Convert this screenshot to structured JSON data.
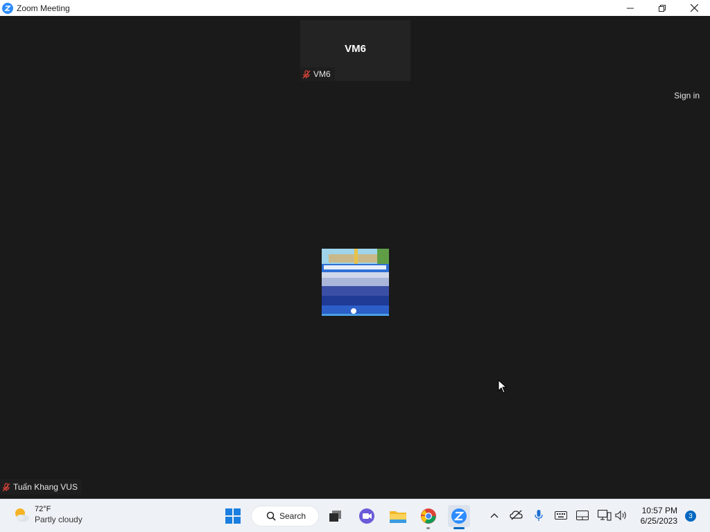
{
  "window": {
    "title": "Zoom Meeting",
    "icons": {
      "app": "zoom-logo-icon",
      "minimize": "minimize-icon",
      "restore": "restore-icon",
      "close": "close-icon"
    }
  },
  "meeting": {
    "top_tile": {
      "display_name": "VM6",
      "label": "VM6",
      "mic_icon": "muted-mic-icon"
    },
    "sign_in_label": "Sign in",
    "center_tile": {
      "image": "group-photo"
    },
    "self_tile": {
      "label": "Tuấn Khang VUS",
      "mic_icon": "muted-mic-icon"
    }
  },
  "taskbar": {
    "weather": {
      "temp": "72°F",
      "condition": "Partly cloudy",
      "icon": "partly-cloudy-icon"
    },
    "search_label": "Search",
    "pinned": [
      "windows-start-icon",
      "search-icon",
      "task-view-icon",
      "teams-chat-icon",
      "file-explorer-icon",
      "chrome-icon",
      "zoom-icon"
    ],
    "tray": [
      "chevron-up-icon",
      "onedrive-offline-icon",
      "microphone-icon",
      "keyboard-icon",
      "touchpad-icon",
      "network-icon",
      "volume-icon"
    ],
    "clock": {
      "time": "10:57 PM",
      "date": "6/25/2023"
    },
    "notification_count": "3"
  },
  "colors": {
    "stage_bg": "#1a1a1a",
    "zoom_blue": "#2d8cff",
    "muted_red": "#e0453a",
    "taskbar_bg": "#eef1f6",
    "accent": "#0067c0"
  }
}
